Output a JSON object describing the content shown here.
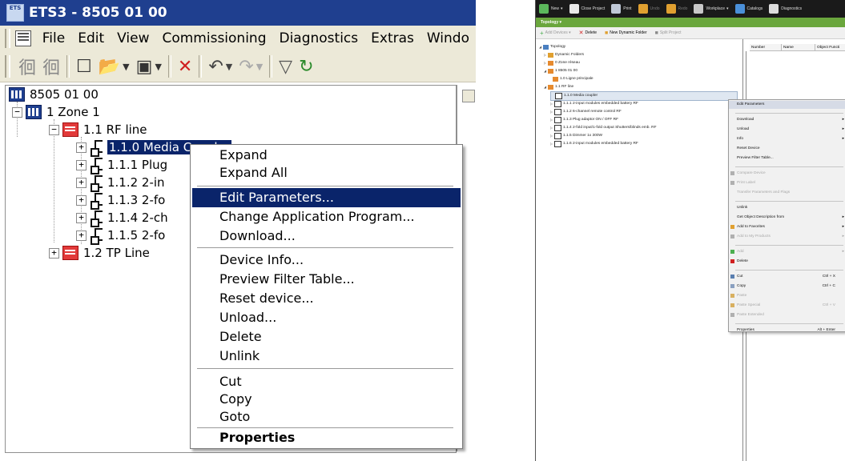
{
  "left": {
    "title": "ETS3 - 8505 01 00",
    "app_icon_text": "ETS",
    "menu": [
      "File",
      "Edit",
      "View",
      "Commissioning",
      "Diagnostics",
      "Extras",
      "Windo"
    ],
    "tree": {
      "root": "8505 01 00",
      "zone": "1 Zone 1",
      "line1": "1.1 RF line",
      "devices": [
        "1.1.0 Media Coupler",
        "1.1.1 Plug",
        "1.1.2 2-in",
        "1.1.3 2-fo",
        "1.1.4 2-ch",
        "1.1.5 2-fo"
      ],
      "line2": "1.2 TP Line"
    },
    "context_menu": {
      "items": [
        "Expand",
        "Expand All",
        "Edit Parameters...",
        "Change Application Program...",
        "Download...",
        "Device Info...",
        "Preview Filter Table...",
        "Reset device...",
        "Unload...",
        "Delete",
        "Unlink",
        "Cut",
        "Copy",
        "Goto",
        "Properties"
      ],
      "highlighted": "Edit Parameters..."
    }
  },
  "right": {
    "toolbar": [
      "New",
      "Close Project",
      "Print",
      "Undo",
      "Redo",
      "Workplace",
      "Catalogs",
      "Diagnostics"
    ],
    "panel_title": "Topology",
    "subtoolbar": [
      "Add Devices",
      "Delete",
      "New Dynamic Folder",
      "Split Project"
    ],
    "tree": [
      "Topology",
      "Dynamic Folders",
      "0 Zone réseau",
      "1 8505 01 00",
      "1.0 Ligne principale",
      "1.1 RF line",
      "1.1.0  Media coupler",
      "1.1.1  2-input modules embedded battery RF",
      "1.1.2  6-channel remote control RF",
      "1.1.3  Plug adaptor ON / OFF RF",
      "1.1.4  2-fold input/1-fold output Shutters/blinds emb. RF",
      "1.1.5  Dimmer 1x 300W",
      "1.1.6  2-input modules embedded battery RF"
    ],
    "grid_headers": [
      "Number",
      "Name",
      "Object Functi"
    ],
    "context_menu": [
      {
        "label": "Edit Parameters",
        "hi": true
      },
      {
        "label": "Download",
        "sub": true
      },
      {
        "label": "Unload",
        "sub": true
      },
      {
        "label": "Info",
        "sub": true
      },
      {
        "label": "Reset Device"
      },
      {
        "label": "Preview Filter Table..."
      },
      {
        "label": "Compare Device",
        "dis": true
      },
      {
        "label": "Print Label",
        "dis": true
      },
      {
        "label": "Transfer Parameters and Flags",
        "dis": true
      },
      {
        "label": "Unlink"
      },
      {
        "label": "Get Object Description from",
        "sub": true
      },
      {
        "label": "Add to Favorites",
        "sub": true
      },
      {
        "label": "Add to My Products",
        "dis": true,
        "sub": true
      },
      {
        "label": "Add",
        "dis": true,
        "sub": true
      },
      {
        "label": "Delete"
      },
      {
        "label": "Cut",
        "shortcut": "Ctrl + X"
      },
      {
        "label": "Copy",
        "shortcut": "Ctrl + C"
      },
      {
        "label": "Paste",
        "dis": true
      },
      {
        "label": "Paste Special",
        "dis": true,
        "shortcut": "Ctrl + V"
      },
      {
        "label": "Paste Extended",
        "dis": true
      },
      {
        "label": "Properties",
        "shortcut": "Alt + Enter"
      }
    ]
  }
}
